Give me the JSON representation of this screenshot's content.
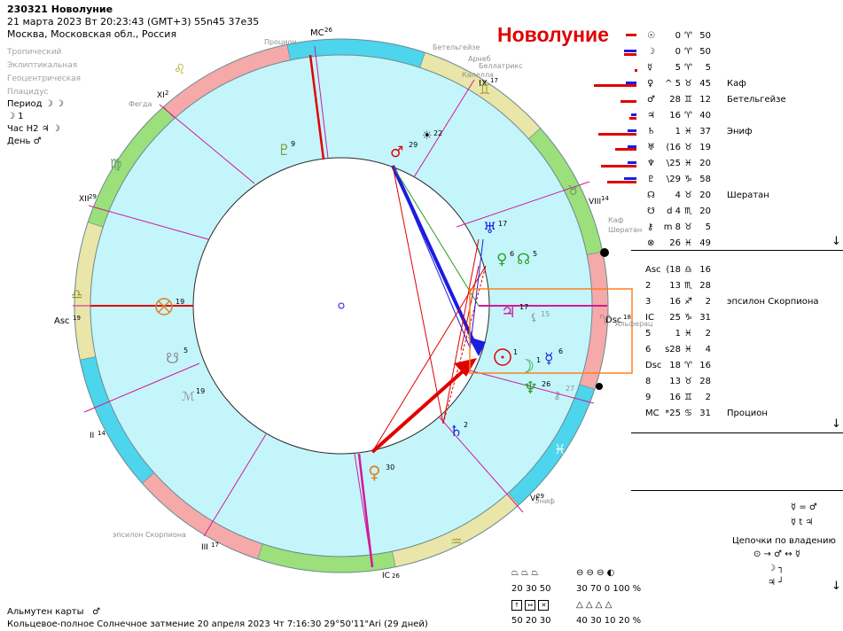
{
  "header": {
    "title": "230321 Новолуние",
    "datetime": "21 марта 2023  Вт  20:23:43 (GMT+3) 55n45  37e35",
    "place": "Москва, Московская обл., Россия",
    "settings": [
      "Тропический",
      "Эклиптикальная",
      "Геоцентрическая",
      "Плацидус"
    ],
    "period_label": "Период",
    "period_value": "☽ ☽",
    "moon_line": "☽   1",
    "hour_label": "Час H2",
    "hour_value": "♃ ☽",
    "day_label": "День",
    "day_value": "♂"
  },
  "banner": "Новолуние",
  "colors": {
    "fire": "#f5a9a9",
    "earth": "#9be07a",
    "air": "#eae5a8",
    "water": "#4cd5ec",
    "inner": "#c4f5fb",
    "accent_red": "#e00000",
    "aspect_blue": "#1c1ce0"
  },
  "wheel": {
    "cusp_labels": [
      "MC",
      "26",
      "IX",
      "17",
      "VIII",
      "14",
      "Dsc",
      "18",
      "VI",
      "29",
      "V",
      "2",
      "IC",
      "26",
      "III",
      "17",
      "II",
      "14",
      "Asc",
      "19",
      "XII",
      "29",
      "XI",
      "2"
    ],
    "stars": [
      "Процион",
      "Бетельгейзе",
      "Арнеб",
      "Беллатрикс",
      "Капелла",
      "Каф",
      "Шератан",
      "Альферац",
      "Эниф",
      "эпсилон Скорпиона",
      "Фегда"
    ],
    "planet_degrees": {
      "mars": "29",
      "pluto": "9",
      "neptune_top": "22",
      "uranus": "17",
      "venus": "6",
      "node": "5",
      "jupiter": "17",
      "lilith": "15",
      "sun": "1",
      "moon": "1",
      "mercury": "6",
      "neptune": "26",
      "chiron": "27",
      "saturn": "2",
      "venus_lower": "30",
      "pf": "19",
      "node_s": "5",
      "mc": "19"
    }
  },
  "planets": [
    {
      "glyph": "☉",
      "deg": "0",
      "sign": "♈",
      "min": "50",
      "star": ""
    },
    {
      "glyph": "☽",
      "deg": "0",
      "sign": "♈",
      "min": "50",
      "star": ""
    },
    {
      "glyph": "☿",
      "deg": "5",
      "sign": "♈",
      "min": "5",
      "star": ""
    },
    {
      "glyph": "♀",
      "deg": "^ 5",
      "sign": "♉",
      "min": "45",
      "star": "Каф"
    },
    {
      "glyph": "♂",
      "deg": "28",
      "sign": "♊",
      "min": "12",
      "star": "Бетельгейзе"
    },
    {
      "glyph": "♃",
      "deg": "16",
      "sign": "♈",
      "min": "40",
      "star": ""
    },
    {
      "glyph": "♄",
      "deg": "1",
      "sign": "♓",
      "min": "37",
      "star": "Эниф"
    },
    {
      "glyph": "♅",
      "deg": "(16",
      "sign": "♉",
      "min": "19",
      "star": ""
    },
    {
      "glyph": "♆",
      "deg": "\\25",
      "sign": "♓",
      "min": "20",
      "star": ""
    },
    {
      "glyph": "♇",
      "deg": "\\29",
      "sign": "♑",
      "min": "58",
      "star": ""
    },
    {
      "glyph": "☊",
      "deg": "4",
      "sign": "♉",
      "min": "20",
      "star": "Шератан"
    },
    {
      "glyph": "☋",
      "deg": "d 4",
      "sign": "♏",
      "min": "20",
      "star": ""
    },
    {
      "glyph": "⚷",
      "deg": "m 8",
      "sign": "♉",
      "min": "5",
      "star": ""
    },
    {
      "glyph": "⊗",
      "deg": "26",
      "sign": "♓",
      "min": "49",
      "star": ""
    }
  ],
  "houses": [
    {
      "label": "Asc",
      "deg": "(18",
      "sign": "♎",
      "min": "16",
      "star": ""
    },
    {
      "label": "2",
      "deg": "13",
      "sign": "♏",
      "min": "28",
      "star": ""
    },
    {
      "label": "3",
      "deg": "16",
      "sign": "♐",
      "min": "2",
      "star": "эпсилон Скорпиона"
    },
    {
      "label": "IC",
      "deg": "25",
      "sign": "♑",
      "min": "31",
      "star": ""
    },
    {
      "label": "5",
      "deg": "1",
      "sign": "♓",
      "min": "2",
      "star": ""
    },
    {
      "label": "6",
      "deg": "s28",
      "sign": "♓",
      "min": "4",
      "star": ""
    },
    {
      "label": "Dsc",
      "deg": "18",
      "sign": "♈",
      "min": "16",
      "star": ""
    },
    {
      "label": "8",
      "deg": "13",
      "sign": "♉",
      "min": "28",
      "star": ""
    },
    {
      "label": "9",
      "deg": "16",
      "sign": "♊",
      "min": "2",
      "star": ""
    },
    {
      "label": "MC",
      "deg": "*25",
      "sign": "♋",
      "min": "31",
      "star": "Процион"
    }
  ],
  "rulers": {
    "line1": "☿ = ♂",
    "line2": "☿ t ♃",
    "title": "Цепочки по владению",
    "chain": "⊙ → ♂ ↔ ☿",
    "chain2": "☽ ┐",
    "chain3": "♃ ┘"
  },
  "stats": {
    "row1_icons": "⏢ ⏢ ⏢",
    "row1_vals": "20  30  50",
    "row1b_icons": "⊖ ⊖ ⊖ ◐",
    "row1b_vals": "30  70   0   100 %",
    "row2_vals": "50  20  30",
    "row2b_icons": "△ △ △ △",
    "row2b_vals": "40  30  10  20 %"
  },
  "footer": {
    "almuten_label": "Альмутен карты",
    "almuten_value": "♂",
    "eclipse": "Кольцевое-полное Солнечное затмение 20 апреля 2023 Чт  7:16:30 29°50'11\"Ari (29 дней)"
  }
}
